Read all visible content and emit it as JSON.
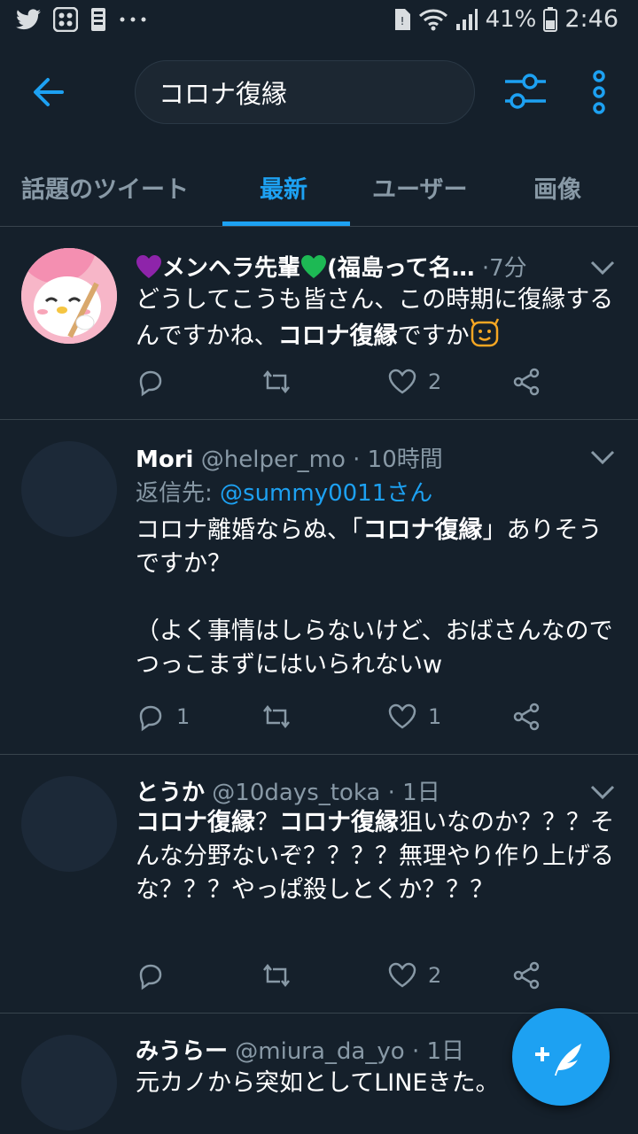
{
  "status_bar": {
    "battery_pct": "41%",
    "time": "2:46",
    "left_icons": [
      "twitter-bird-icon",
      "app-grid-icon",
      "sim-icon",
      "more-notifications-icon"
    ],
    "right_icons": [
      "sim-alert-icon",
      "wifi-icon",
      "signal-icon",
      "battery-icon"
    ]
  },
  "header": {
    "search_value": "コロナ復縁",
    "icons": [
      "back-arrow-icon",
      "filter-sliders-icon",
      "vertical-dots-icon"
    ]
  },
  "tabs": [
    {
      "label": "話題のツイート",
      "active": false
    },
    {
      "label": "最新",
      "active": true
    },
    {
      "label": "ユーザー",
      "active": false
    },
    {
      "label": "画像",
      "active": false
    }
  ],
  "tweets": [
    {
      "name_prefix": "",
      "name_core": "メンヘラ先輩",
      "name_suffix": "(福島って名…",
      "handle": "",
      "sep": "·",
      "time": "7分",
      "reply_label": "",
      "reply_mention": "",
      "body": [
        {
          "t": "どうしてこうも皆さん、この時期に復縁するんですかね、",
          "b": false
        },
        {
          "t": "コロナ復縁",
          "b": true
        },
        {
          "t": "ですか",
          "b": false
        }
      ],
      "replies": "",
      "retweets": "",
      "likes": "2"
    },
    {
      "name": "Mori",
      "handle": "@helper_mo",
      "sep": "·",
      "time": "10時間",
      "reply_label": "返信先: ",
      "reply_mention": "@summy0011さん",
      "body_line1_pre": "コロナ離婚ならぬ、「",
      "body_line1_bold": "コロナ復縁",
      "body_line1_post": "」ありそうですか？",
      "body_line2": "（よく事情はしらないけど、おばさんなのでつっこまずにはいられないw",
      "replies": "1",
      "retweets": "",
      "likes": "1"
    },
    {
      "name": "とうか",
      "handle": "@10days_toka",
      "sep": "·",
      "time": "1日",
      "body_b1": "コロナ復縁",
      "body_p1": "？",
      "body_b2": "コロナ復縁",
      "body_p2": "狙いなのか？？？そんな分野ないぞ？？？？無理やり作り上げるな？？？やっぱ殺しとくか？？？",
      "replies": "",
      "retweets": "",
      "likes": "2"
    },
    {
      "name": "みうらー",
      "handle": "@miura_da_yo",
      "sep": "·",
      "time": "1日",
      "body": "元カノから突如としてLINEきた。"
    }
  ],
  "colors": {
    "background": "#15202b",
    "accent": "#1da1f2",
    "secondary_text": "#8899a6",
    "divider": "#38444d",
    "heart_purple": "#8e24aa",
    "heart_green": "#1db954"
  },
  "fab": {
    "icon": "compose-feather-icon"
  }
}
